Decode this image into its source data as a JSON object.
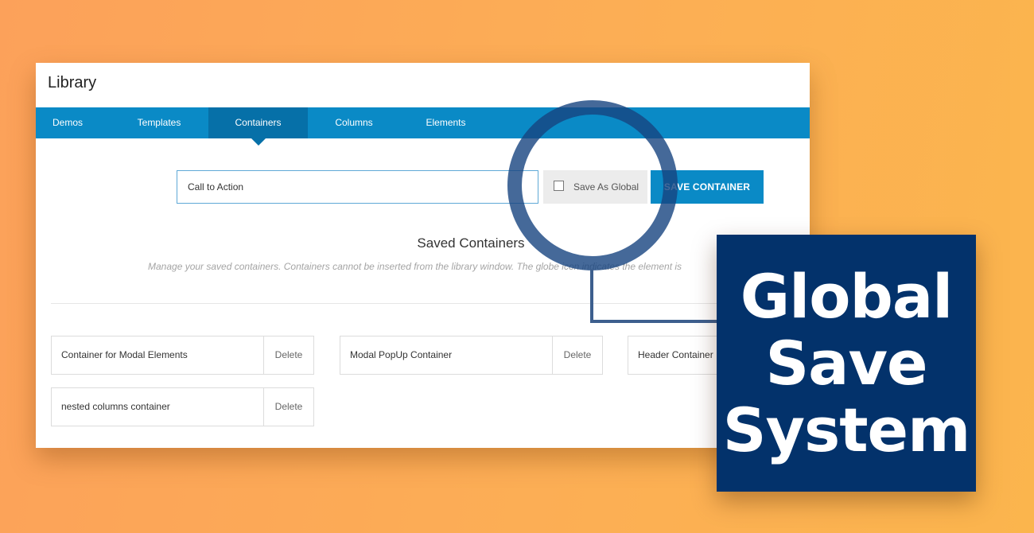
{
  "library": {
    "title": "Library",
    "tabs": [
      {
        "label": "Demos",
        "active": false
      },
      {
        "label": "Templates",
        "active": false
      },
      {
        "label": "Containers",
        "active": true
      },
      {
        "label": "Columns",
        "active": false
      },
      {
        "label": "Elements",
        "active": false
      }
    ],
    "save_form": {
      "name_value": "Call to Action",
      "global_checkbox_label": "Save As Global",
      "global_checked": false,
      "save_button_label": "SAVE CONTAINER"
    },
    "saved": {
      "heading": "Saved Containers",
      "description": "Manage your saved containers. Containers cannot be inserted from the library window. The globe icon indicates the element is",
      "delete_label": "Delete",
      "items": [
        {
          "name": "Container for Modal Elements"
        },
        {
          "name": "Modal PopUp Container"
        },
        {
          "name": "Header Container"
        },
        {
          "name": "nested columns container"
        }
      ]
    }
  },
  "callout": {
    "text": "Global\nSave\nSystem"
  },
  "colors": {
    "accent": "#0a8ac6",
    "accent_dark": "#0670a8",
    "callout_bg": "#03326b"
  }
}
